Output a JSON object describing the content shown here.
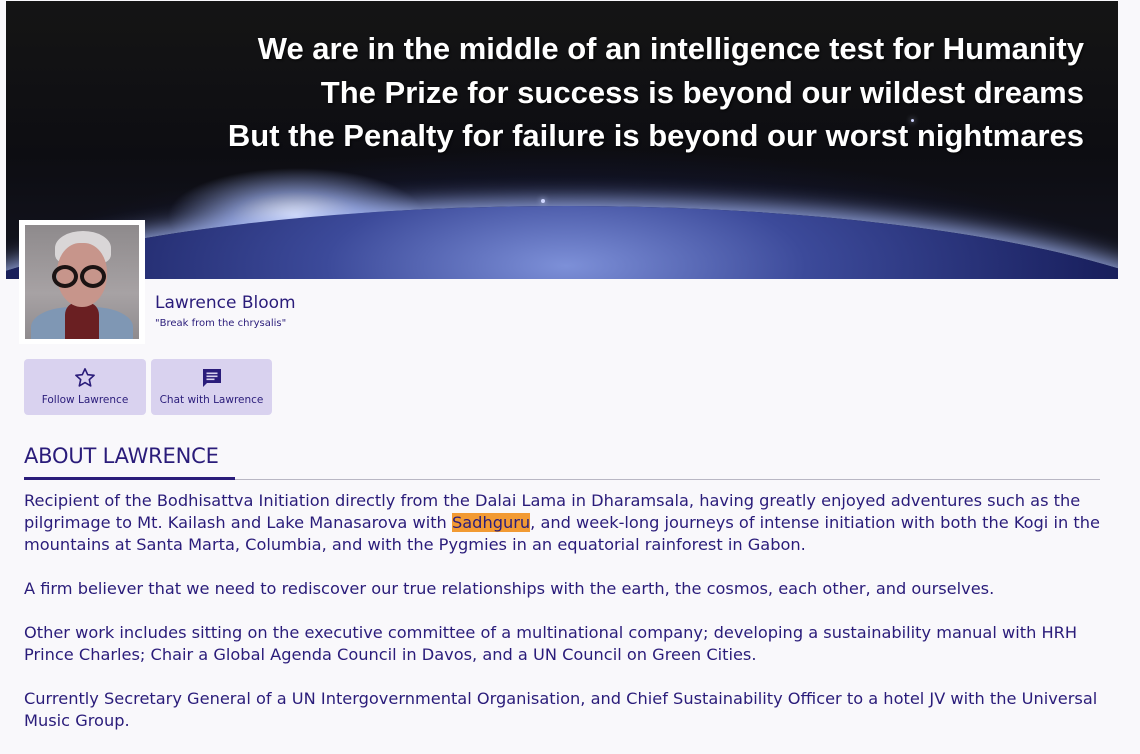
{
  "banner": {
    "quote_lines": [
      "We are in the middle of an intelligence test for Humanity",
      "The Prize for success is beyond our wildest dreams",
      "But the Penalty for failure is beyond our worst nightmares"
    ]
  },
  "profile": {
    "name": "Lawrence Bloom",
    "tagline": "\"Break from the chrysalis\""
  },
  "actions": {
    "follow": {
      "label": "Follow Lawrence",
      "icon": "star-icon"
    },
    "chat": {
      "label": "Chat with Lawrence",
      "icon": "chat-icon"
    }
  },
  "about": {
    "heading": "ABOUT LAWRENCE",
    "p1_before": "Recipient of the Bodhisattva Initiation directly from the Dalai Lama in Dharamsala, having greatly enjoyed adventures such as the pilgrimage to Mt. Kailash and Lake Manasarova with ",
    "p1_highlight": "Sadhguru",
    "p1_after": ", and week-long journeys of intense initiation with both the Kogi in the mountains at Santa Marta, Columbia, and with the Pygmies in an equatorial rainforest in Gabon.",
    "p2": "A firm believer that we need to rediscover our true relationships with the earth, the cosmos, each other, and ourselves.",
    "p3": "Other work includes sitting on the executive committee of a multinational company; developing a sustainability manual with HRH Prince Charles; Chair a Global Agenda Council in Davos, and a UN Council on Green Cities.",
    "p4": "Currently Secretary General of a UN Intergovernmental Organisation, and Chief Sustainability Officer to a hotel JV with the Universal Music Group.",
    "highlight_color": "#f29a33"
  },
  "colors": {
    "text": "#2a1c7a",
    "button_bg": "#d9d2ef",
    "page_bg": "#f9f8fb"
  }
}
